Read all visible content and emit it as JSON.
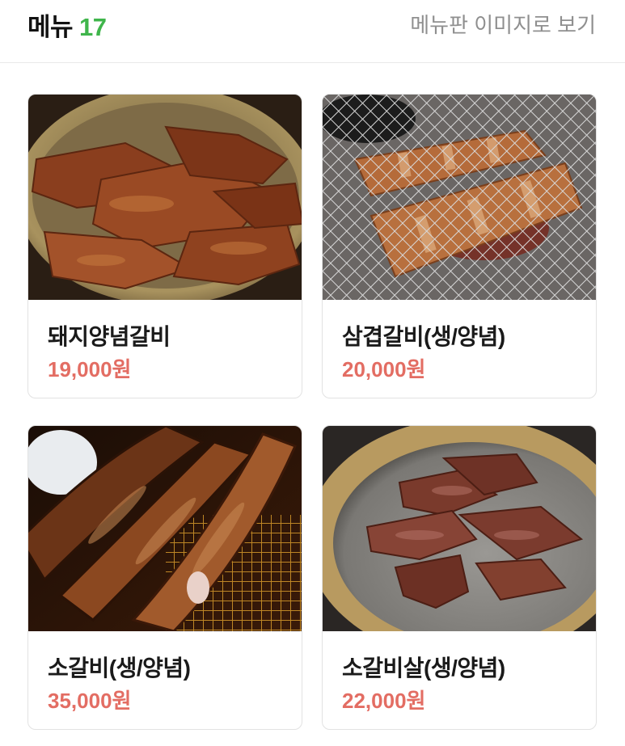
{
  "header": {
    "title": "메뉴",
    "count": "17",
    "view_image_link": "메뉴판 이미지로 보기"
  },
  "menu_items": [
    {
      "name": "돼지양념갈비",
      "price": "19,000원",
      "photo": "marinated-pork-ribs-photo"
    },
    {
      "name": "삼겹갈비(생/양념)",
      "price": "20,000원",
      "photo": "pork-belly-ribs-photo"
    },
    {
      "name": "소갈비(생/양념)",
      "price": "35,000원",
      "photo": "beef-ribs-photo"
    },
    {
      "name": "소갈비살(생/양념)",
      "price": "22,000원",
      "photo": "beef-rib-meat-photo"
    }
  ],
  "colors": {
    "accent_green": "#3fb54b",
    "price_red": "#e36d63",
    "link_gray": "#8f8f8f"
  }
}
